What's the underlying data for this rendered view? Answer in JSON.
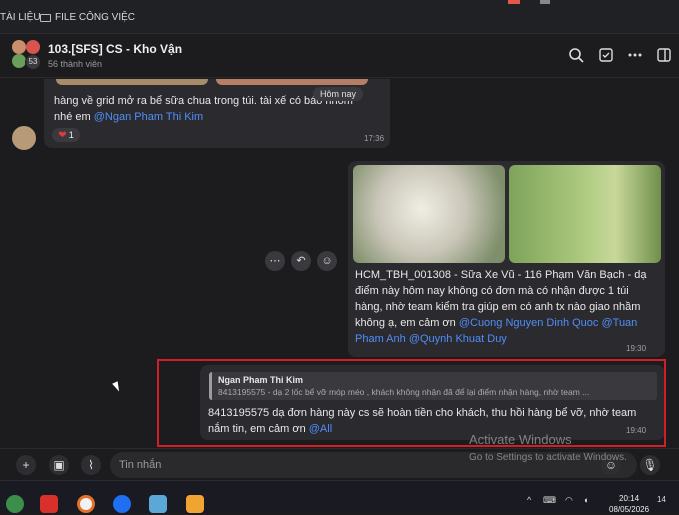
{
  "bookmarks": {
    "left_item": "TÀI LIỆU",
    "folder_item": "FILE CÔNG VIỆC"
  },
  "header": {
    "title": "103.[SFS] CS - Kho Vận",
    "members": "56 thành viên",
    "avatar_count": "53"
  },
  "date_separator": "Hôm nay",
  "messages": [
    {
      "side": "left",
      "text_before": "hàng về grid mở ra bể sữa chua trong túi. tài xế có báo nhóm",
      "text_line2": "nhé em ",
      "mention": "@Ngan Pham Thi Kim",
      "time": "17:36",
      "reaction_count": "1"
    },
    {
      "side": "right",
      "text": "HCM_TBH_001308 - Sữa Xe Vũ - 116 Phạm Văn Bạch - dạ điểm này hôm nay không có đơn mà có nhận được 1 túi hàng, nhờ team kiểm tra giúp em có anh tx nào giao nhầm không ạ, em cảm ơn ",
      "mentions": "@Cuong Nguyen Dinh Quoc @Tuan Pham Anh @Quynh Khuat Duy",
      "time": "19:30"
    },
    {
      "side": "right",
      "quote_name": "Ngan Pham Thi Kim",
      "quote_text": "8413195575 - dạ 2 lốc bể vỡ móp méo , khách không nhận đã để lại điểm nhận hàng, nhờ team ...",
      "text": "8413195575  dạ đơn hàng  này cs sẽ hoàn tiền cho khách, thu hồi hàng bể vỡ,  nhờ team nắm tin, em cảm ơn ",
      "mention": "@All",
      "time": "19:40"
    }
  ],
  "composer": {
    "placeholder": "Tin nhắn"
  },
  "watermark": {
    "title": "Activate Windows",
    "subtitle": "Go to Settings to activate Windows."
  },
  "taskbar": {
    "time": "20:14",
    "date": "08/05/2026",
    "notif": "14"
  },
  "colors": {
    "accent_mention": "#4f8ef7",
    "highlight_box": "#d11f2a",
    "bubble": "#2b2b2f"
  },
  "icons": [
    "search-icon",
    "calendar-check-icon",
    "more-icon",
    "panel-icon",
    "add-icon",
    "image-icon",
    "attach-icon",
    "emoji-icon",
    "mic-icon",
    "reply-icon"
  ]
}
